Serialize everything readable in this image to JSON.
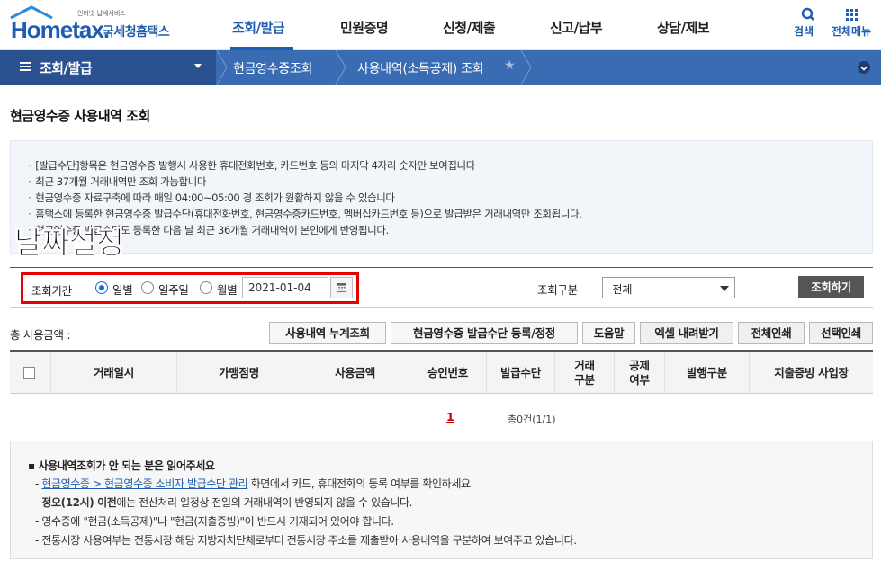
{
  "header": {
    "logo_word": "Hometax.",
    "logo_sub": "인터넷 납세서비스",
    "logo_name": "국세청홈택스",
    "menu": [
      {
        "label": "조회/발급",
        "active": true
      },
      {
        "label": "민원증명",
        "active": false
      },
      {
        "label": "신청/제출",
        "active": false
      },
      {
        "label": "신고/납부",
        "active": false
      },
      {
        "label": "상담/제보",
        "active": false
      }
    ],
    "search_label": "검색",
    "allmenu_label": "전체메뉴"
  },
  "nav2": {
    "section": "조회/발급",
    "crumb1": "현금영수증조회",
    "crumb2": "사용내역(소득공제) 조회"
  },
  "page_title": "현금영수증 사용내역 조회",
  "info": {
    "items": [
      "[발급수단]항목은 현금영수증 발행시 사용한 휴대전화번호, 카드번호 등의 마지막 4자리 숫자만 보여집니다",
      "최근 37개월 거래내역만 조회 가능합니다",
      "현금영수증 자료구축에 따라 매일 04:00~05:00 경 조회가 원활하지 않을 수 있습니다",
      "홈택스에 등록한 현금영수증 발급수단(휴대전화번호, 현금영수증카드번호, 멤버십카드번호 등)으로 발급받은 거래내역만 조회됩니다.",
      "현금영수증 발급수단도 등록한 다음 날 최근 36개월 거래내역이 본인에게 반영됩니다."
    ]
  },
  "overlay_text": "날짜설정",
  "search": {
    "period_label": "조회기간",
    "radios": [
      {
        "label": "일별",
        "checked": true
      },
      {
        "label": "일주일",
        "checked": false
      },
      {
        "label": "월별",
        "checked": false
      }
    ],
    "date_value": "2021-01-04",
    "type_label": "조회구분",
    "type_value": "-전체-",
    "search_button": "조회하기"
  },
  "toolbar": {
    "total_label": "총 사용금액 :",
    "buttons": [
      "사용내역 누계조회",
      "현금영수증 발급수단 등록/정정",
      "도움말",
      "엑셀 내려받기",
      "전체인쇄",
      "선택인쇄"
    ]
  },
  "table": {
    "columns": [
      "거래일시",
      "가맹점명",
      "사용금액",
      "승인번호",
      "발급수단",
      "거래\n구분",
      "공제\n여부",
      "발행구분",
      "지출증빙 사업장"
    ]
  },
  "pager": {
    "page": "1",
    "count": "총0건(1/1)"
  },
  "notice": {
    "title": "사용내역조회가 안 되는 분은 읽어주세요",
    "link": "현금영수증 > 현금영수증 소비자 발급수단 관리",
    "link_suffix": " 화면에서 카드, 휴대전화의 등록 여부를 확인하세요.",
    "line2_bold": "정오(12시) 이전",
    "line2_rest": "에는 전산처리 일정상 전일의 거래내역이 반영되지 않을 수 있습니다.",
    "line3": "영수증에 \"현금(소득공제)\"나 \"현금(지출증빙)\"이 반드시 기재되어 있어야 합니다.",
    "line4": "전통시장 사용여부는 전통시장 해당 지방자치단체로부터 전통시장 주소를 제출받아 사용내역을 구분하여 보여주고 있습니다."
  }
}
